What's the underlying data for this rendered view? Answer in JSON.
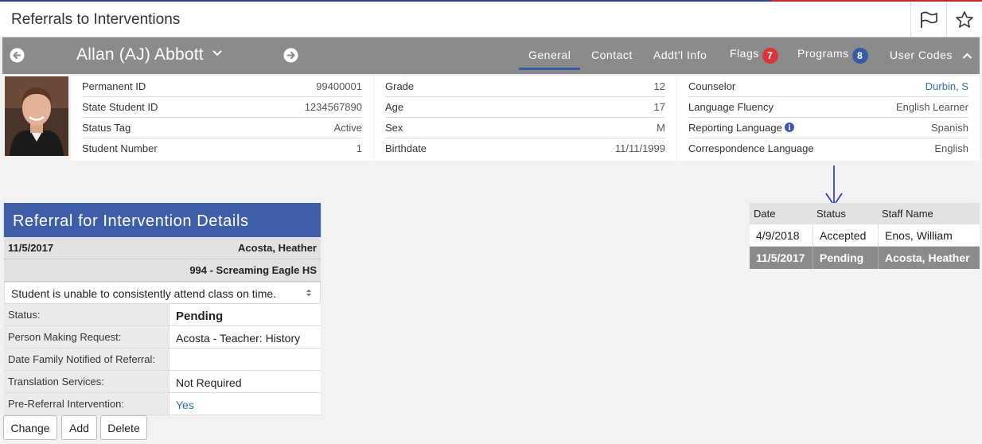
{
  "page": {
    "title": "Referrals to Interventions",
    "flag_icon": "flag-icon",
    "star_icon": "star-icon"
  },
  "student_bar": {
    "student_name": "Allan (AJ) Abbott",
    "prev_icon": "arrow-left-circle-icon",
    "next_icon": "arrow-right-circle-icon",
    "tabs": [
      {
        "label": "General",
        "active": true
      },
      {
        "label": "Contact"
      },
      {
        "label": "Addt'l Info"
      },
      {
        "label": "Flags",
        "badge": "7",
        "badge_color": "#d9353b"
      },
      {
        "label": "Programs",
        "badge": "8",
        "badge_color": "#3b5aa6"
      },
      {
        "label": "User Codes"
      }
    ]
  },
  "student_info": {
    "col1": [
      {
        "label": "Permanent ID",
        "value": "99400001"
      },
      {
        "label": "State Student ID",
        "value": "1234567890"
      },
      {
        "label": "Status Tag",
        "value": "Active"
      },
      {
        "label": "Student Number",
        "value": "1"
      }
    ],
    "col2": [
      {
        "label": "Grade",
        "value": "12"
      },
      {
        "label": "Age",
        "value": "17"
      },
      {
        "label": "Sex",
        "value": "M"
      },
      {
        "label": "Birthdate",
        "value": "11/11/1999"
      }
    ],
    "col3": [
      {
        "label": "Counselor",
        "value": "Durbin, S"
      },
      {
        "label": "Language Fluency",
        "value": "English Learner"
      },
      {
        "label": "Reporting Language",
        "value": "Spanish"
      },
      {
        "label": "Correspondence Language",
        "value": "English"
      }
    ]
  },
  "referral_details": {
    "header": "Referral for Intervention Details",
    "date": "11/5/2017",
    "staff": "Acosta, Heather",
    "school": "994 - Screaming Eagle HS",
    "description": "Student is unable to consistently attend class on time.",
    "fields": [
      {
        "label": "Status:",
        "value": "Pending"
      },
      {
        "label": "Person Making Request:",
        "value": "Acosta - Teacher: History"
      },
      {
        "label": "Date Family Notified of Referral:",
        "value": ""
      },
      {
        "label": "Translation Services:",
        "value": "Not Required"
      },
      {
        "label": "Pre-Referral Intervention:",
        "value": "Yes"
      }
    ]
  },
  "history": {
    "headers": [
      "Date",
      "Status",
      "Staff Name"
    ],
    "rows": [
      [
        "4/9/2018",
        "Accepted",
        "Enos, William"
      ],
      [
        "11/5/2017",
        "Pending",
        "Acosta, Heather"
      ]
    ]
  },
  "actions": {
    "change": "Change",
    "add": "Add",
    "delete": "Delete"
  },
  "colors": {
    "header_blue": "#3f5ea8",
    "bar_gray": "#8b8b8b",
    "link_blue": "#2f6db6"
  }
}
